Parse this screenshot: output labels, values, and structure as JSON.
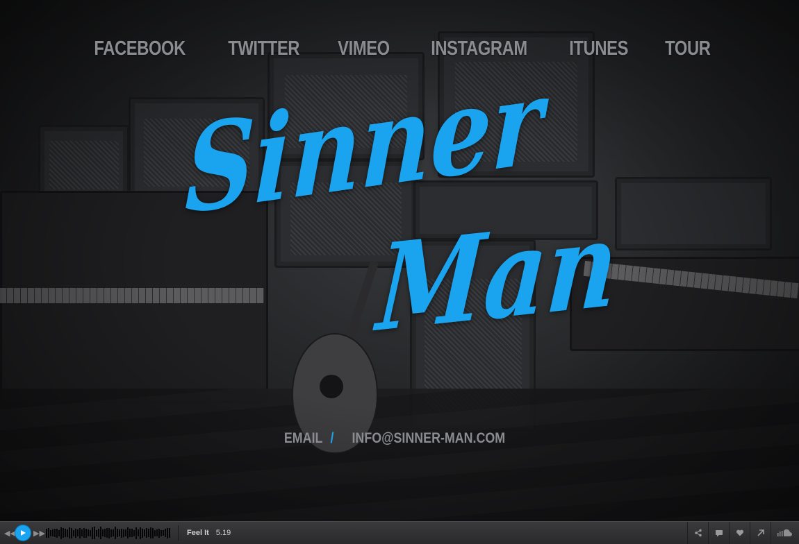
{
  "nav": {
    "items": [
      "FACEBOOK",
      "TWITTER",
      "VIMEO",
      "INSTAGRAM",
      "ITUNES",
      "TOUR"
    ]
  },
  "logo": {
    "line1": "Sinner",
    "line2": "Man",
    "color": "#1aa3ef"
  },
  "contact": {
    "label": "EMAIL",
    "separator": "/",
    "address": "INFO@SINNER-MAN.COM"
  },
  "player": {
    "track_title": "Feel It",
    "duration": "5.19",
    "accent": "#1aa3ef",
    "icons": [
      "prev-icon",
      "play-icon",
      "next-icon",
      "share-icon",
      "comment-icon",
      "like-icon",
      "open-external-icon",
      "soundcloud-icon"
    ]
  }
}
